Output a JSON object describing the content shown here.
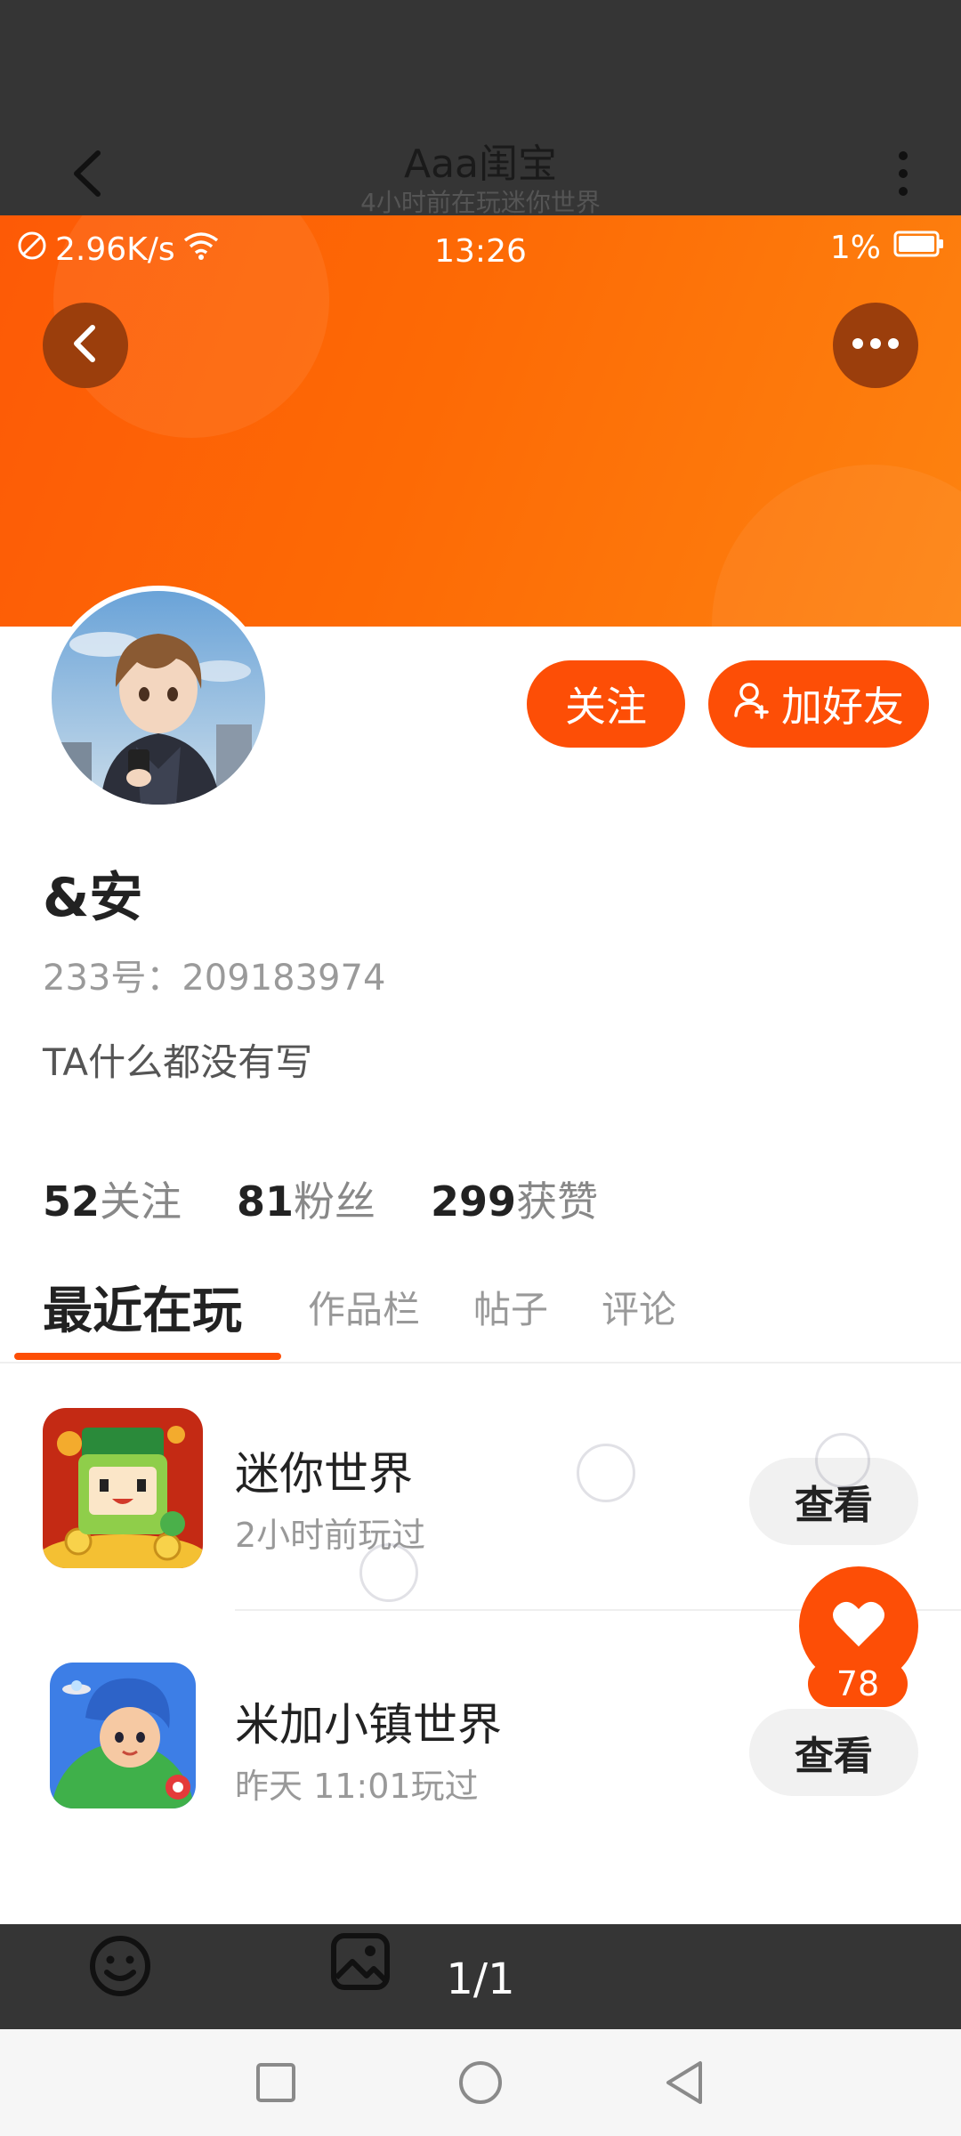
{
  "header": {
    "title": "Aaa闺宝",
    "subtitle": "4小时前在玩迷你世界"
  },
  "status_bar": {
    "net_speed": "2.96K/s",
    "time": "13:26",
    "battery": "1%"
  },
  "profile": {
    "name": "&安",
    "uid": "233号：209183974",
    "bio": "TA什么都没有写",
    "follow_label": "关注",
    "add_friend_label": "加好友"
  },
  "stats": [
    {
      "num": "52",
      "label": "关注"
    },
    {
      "num": "81",
      "label": "粉丝"
    },
    {
      "num": "299",
      "label": "获赞"
    }
  ],
  "tabs": [
    "最近在玩",
    "作品栏",
    "帖子",
    "评论"
  ],
  "games": [
    {
      "name": "迷你世界",
      "time": "2小时前玩过",
      "button": "查看"
    },
    {
      "name": "米加小镇世界",
      "time": "昨天 11:01玩过",
      "button": "查看"
    }
  ],
  "favorite_count": "78",
  "pager": "1/1",
  "colors": {
    "accent": "#fd4e06",
    "banner_start": "#fd5a06",
    "banner_end": "#fd8310",
    "dark_bar": "#353535"
  }
}
